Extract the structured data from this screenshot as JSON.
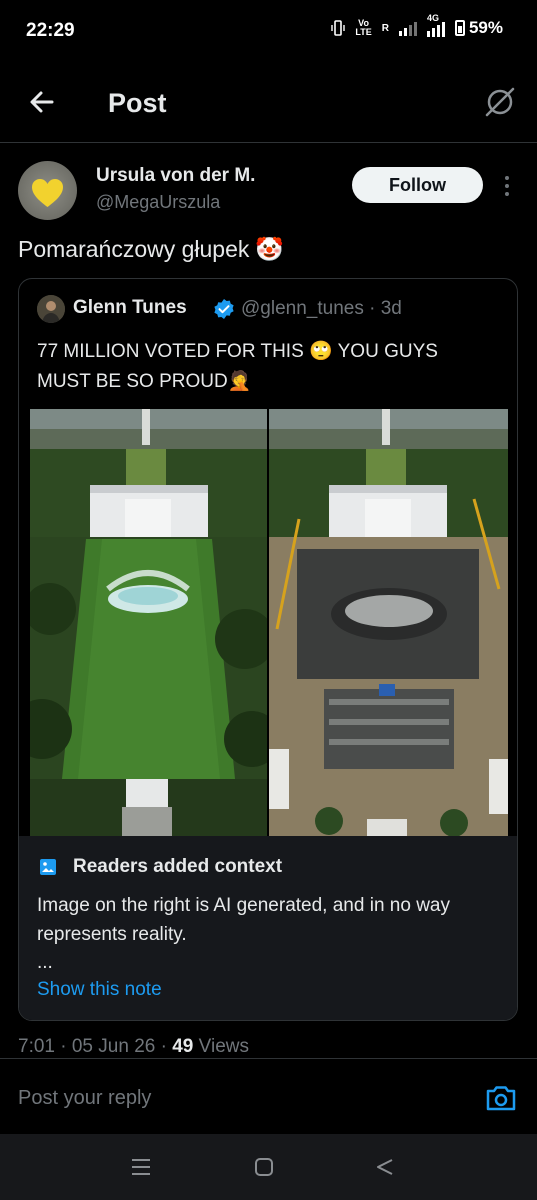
{
  "status_bar": {
    "time": "22:29",
    "network_line1": "Vo",
    "network_line2": "LTE",
    "roaming": "R",
    "network_type": "4G",
    "battery": "59%"
  },
  "header": {
    "title": "Post",
    "back_icon": "arrow-left-icon",
    "grok_icon": "grok-icon"
  },
  "post": {
    "author_name": "Ursula von der M.",
    "author_handle": "@MegaUrszula",
    "follow_label": "Follow",
    "text": "Pomarańczowy głupek",
    "emoji": "🤡",
    "timestamp": "7:01 · 05 Jun 26 · ",
    "views_count": "49",
    "views_label": " Views"
  },
  "quote": {
    "author_name": "Glenn Tunes",
    "author_handle": "@glenn_tunes · 3d",
    "text_line1": "77 MILLION VOTED FOR THIS 🙄 YOU GUYS",
    "text_line2": "MUST BE SO PROUD🤦",
    "verified_color": "#1d9bf0"
  },
  "context_note": {
    "title": "Readers added context",
    "text": "Image on the right is AI generated, and in no way represents reality.",
    "ellipsis": "...",
    "link": "Show this note"
  },
  "reply": {
    "placeholder": "Post your reply"
  },
  "colors": {
    "background": "#000000",
    "accent": "#1d9bf0",
    "muted": "#71767b",
    "border": "#2f3336"
  }
}
